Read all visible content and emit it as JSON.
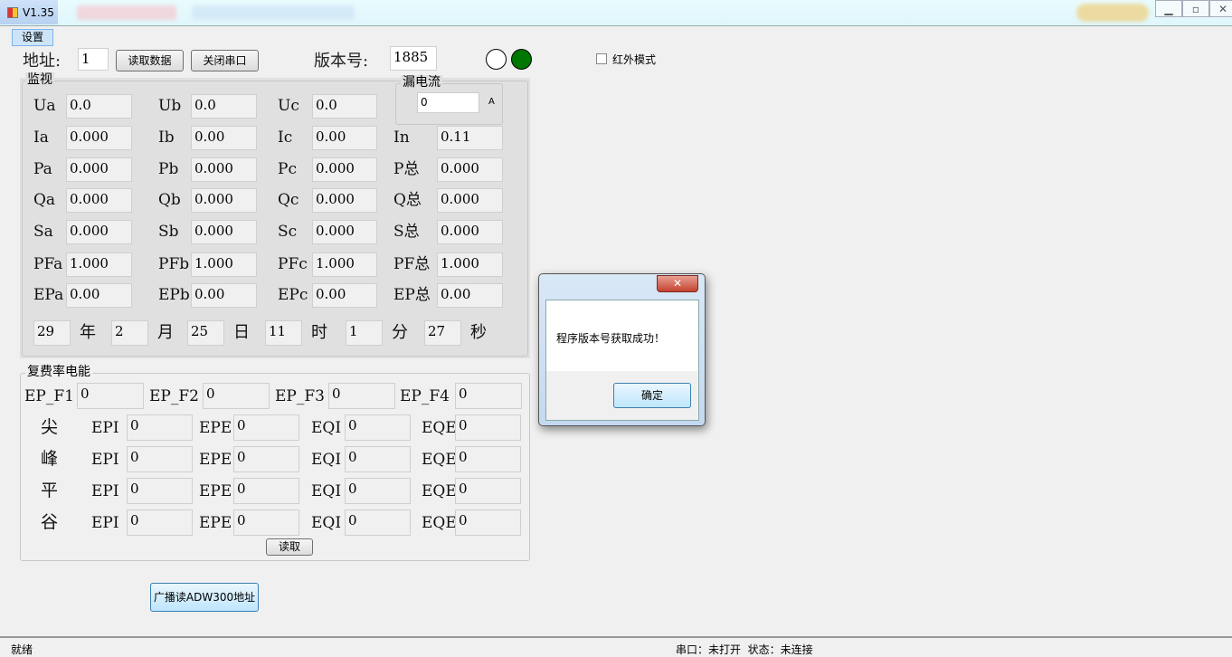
{
  "window": {
    "title": "V1.35",
    "blurred_tab": "···",
    "colors": {
      "accent": "#007700",
      "group_bg": "#e0e0e0"
    }
  },
  "menu": {
    "settings": "设置"
  },
  "toolbar": {
    "address_label": "地址:",
    "address_value": "1",
    "read_data": "读取数据",
    "close_port": "关闭串口",
    "version_label": "版本号:",
    "version_value": "1885",
    "infrared_label": "红外模式",
    "infrared_checked": false,
    "indicator_1": "white",
    "indicator_2": "green"
  },
  "monitor": {
    "title": "监视",
    "leak": {
      "title": "漏电流",
      "value": "0",
      "unit": "A"
    },
    "rows": [
      [
        [
          "Ua",
          "0.0"
        ],
        [
          "Ub",
          "0.0"
        ],
        [
          "Uc",
          "0.0"
        ]
      ],
      [
        [
          "Ia",
          "0.000"
        ],
        [
          "Ib",
          "0.00"
        ],
        [
          "Ic",
          "0.00"
        ],
        [
          "In",
          "0.11"
        ]
      ],
      [
        [
          "Pa",
          "0.000"
        ],
        [
          "Pb",
          "0.000"
        ],
        [
          "Pc",
          "0.000"
        ],
        [
          "P总",
          "0.000"
        ]
      ],
      [
        [
          "Qa",
          "0.000"
        ],
        [
          "Qb",
          "0.000"
        ],
        [
          "Qc",
          "0.000"
        ],
        [
          "Q总",
          "0.000"
        ]
      ],
      [
        [
          "Sa",
          "0.000"
        ],
        [
          "Sb",
          "0.000"
        ],
        [
          "Sc",
          "0.000"
        ],
        [
          "S总",
          "0.000"
        ]
      ],
      [
        [
          "PFa",
          "1.000"
        ],
        [
          "PFb",
          "1.000"
        ],
        [
          "PFc",
          "1.000"
        ],
        [
          "PF总",
          "1.000"
        ]
      ],
      [
        [
          "EPa",
          "0.00"
        ],
        [
          "EPb",
          "0.00"
        ],
        [
          "EPc",
          "0.00"
        ],
        [
          "EP总",
          "0.00"
        ]
      ]
    ],
    "datetime": [
      [
        "29",
        "年"
      ],
      [
        "2",
        "月"
      ],
      [
        "25",
        "日"
      ],
      [
        "11",
        "时"
      ],
      [
        "1",
        "分"
      ],
      [
        "27",
        "秒"
      ]
    ]
  },
  "tariff": {
    "title": "复费率电能",
    "fees": [
      [
        "EP_F1",
        "0"
      ],
      [
        "EP_F2",
        "0"
      ],
      [
        "EP_F3",
        "0"
      ],
      [
        "EP_F4",
        "0"
      ]
    ],
    "rows": [
      {
        "name": "尖",
        "cells": [
          [
            "EPI",
            "0"
          ],
          [
            "EPE",
            "0"
          ],
          [
            "EQI",
            "0"
          ],
          [
            "EQE",
            "0"
          ]
        ]
      },
      {
        "name": "峰",
        "cells": [
          [
            "EPI",
            "0"
          ],
          [
            "EPE",
            "0"
          ],
          [
            "EQI",
            "0"
          ],
          [
            "EQE",
            "0"
          ]
        ]
      },
      {
        "name": "平",
        "cells": [
          [
            "EPI",
            "0"
          ],
          [
            "EPE",
            "0"
          ],
          [
            "EQI",
            "0"
          ],
          [
            "EQE",
            "0"
          ]
        ]
      },
      {
        "name": "谷",
        "cells": [
          [
            "EPI",
            "0"
          ],
          [
            "EPE",
            "0"
          ],
          [
            "EQI",
            "0"
          ],
          [
            "EQE",
            "0"
          ]
        ]
      }
    ],
    "read_button": "读取"
  },
  "broadcast_button": "广播读ADW300地址",
  "statusbar": {
    "left": "就绪",
    "right": "串口：未打开  状态：未连接"
  },
  "dialog": {
    "message": "程序版本号获取成功！",
    "ok": "确定",
    "close": "✕"
  }
}
